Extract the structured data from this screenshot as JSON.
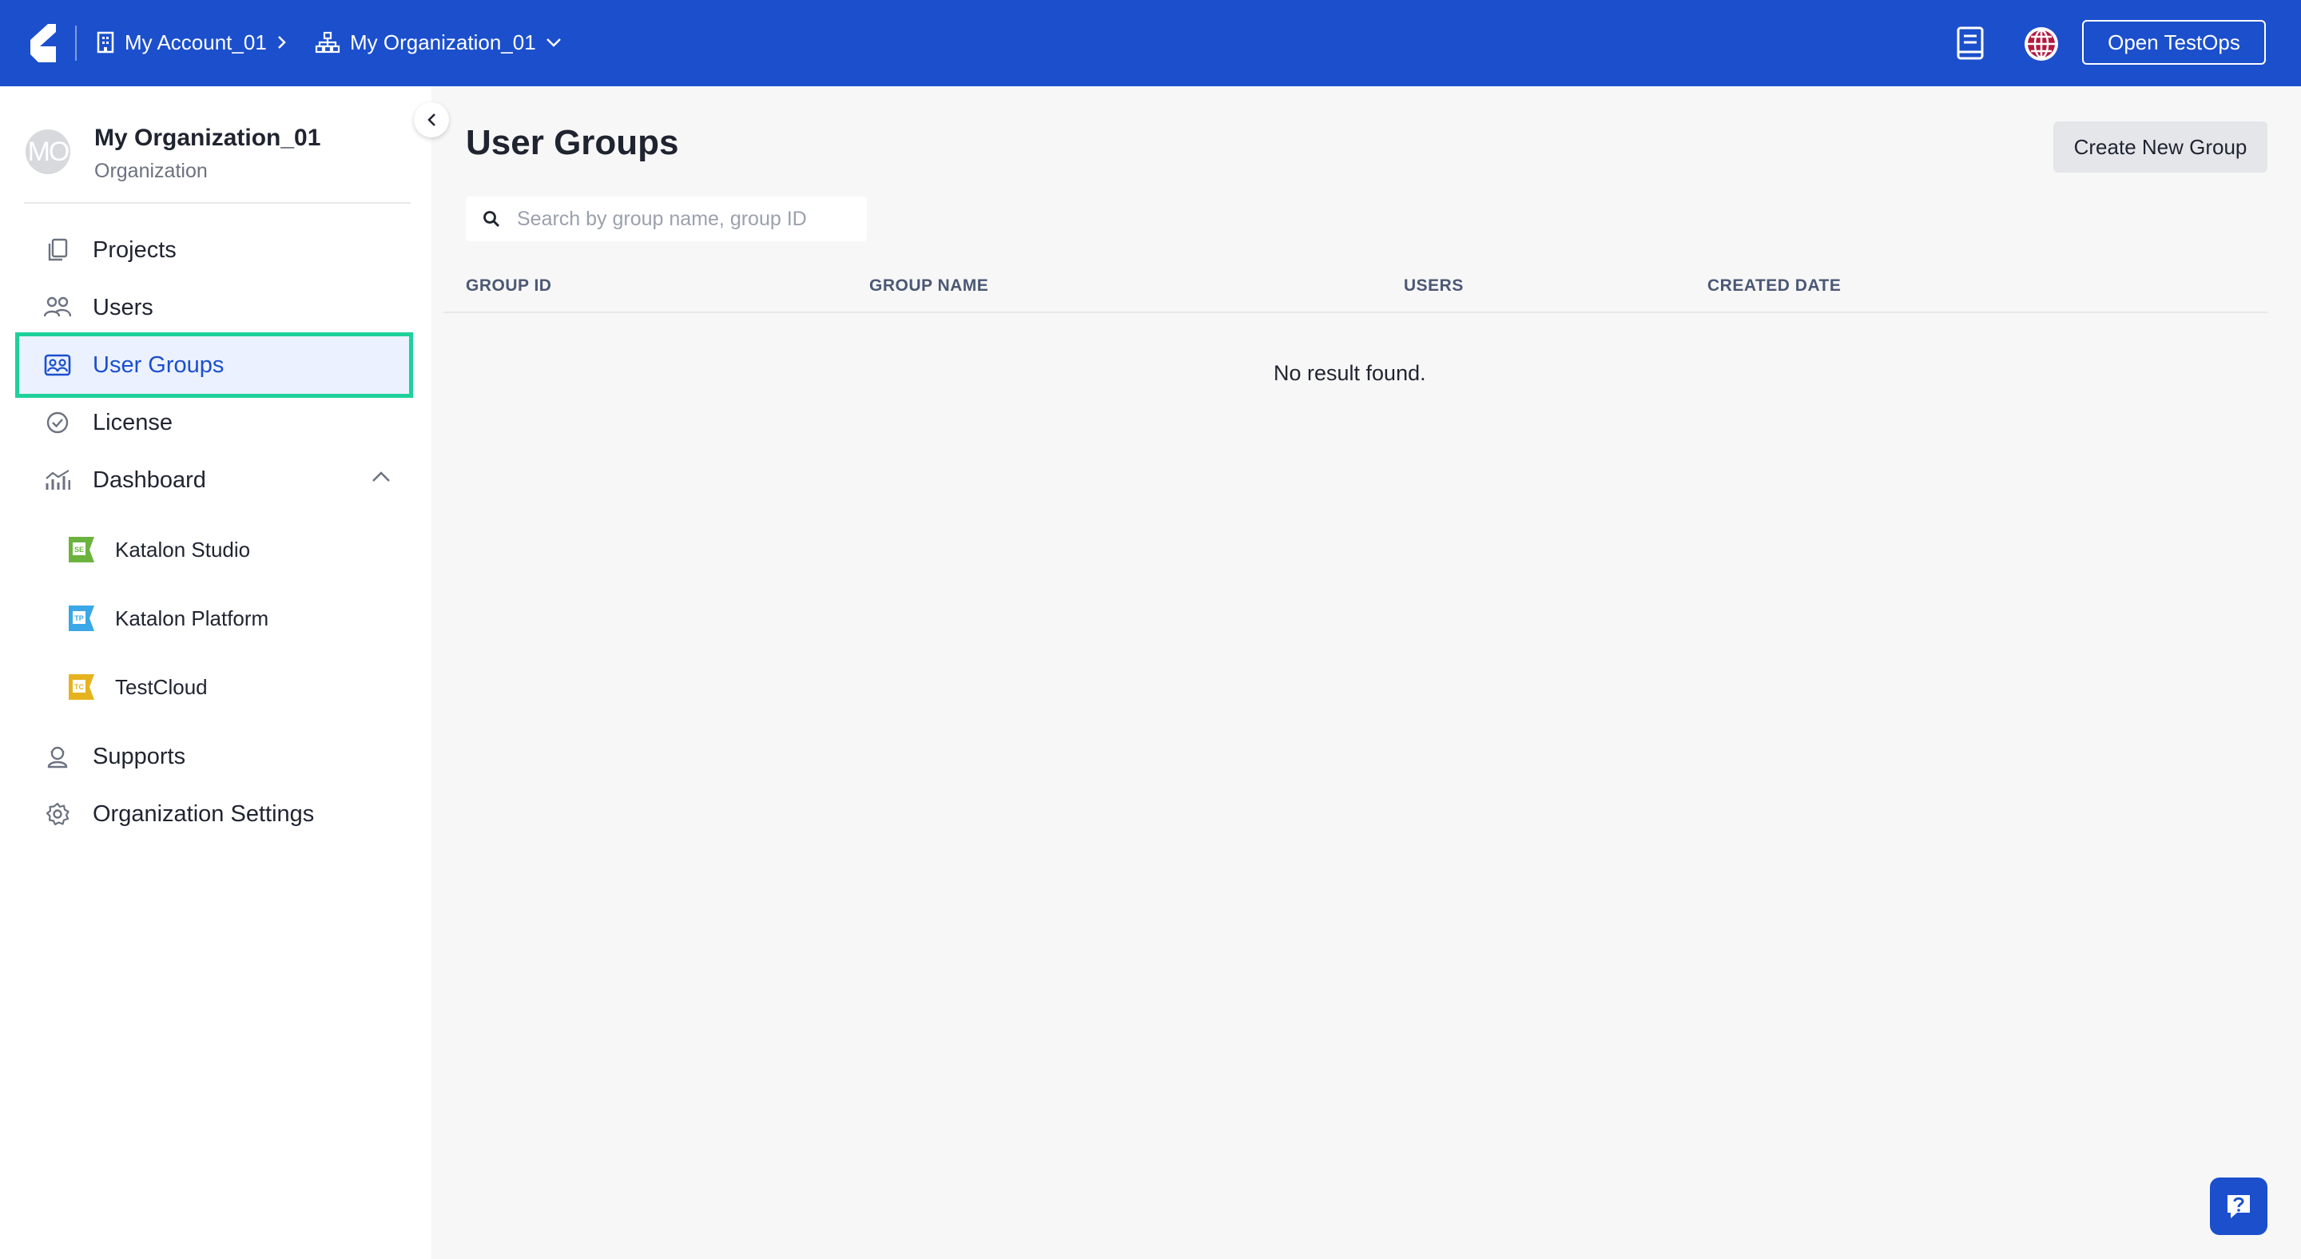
{
  "topbar": {
    "account": "My Account_01",
    "organization": "My Organization_01",
    "open_button": "Open TestOps",
    "brand_color": "#1b4fcc"
  },
  "sidebar": {
    "org_avatar": "MO",
    "org_name": "My Organization_01",
    "org_type": "Organization",
    "items": [
      {
        "label": "Projects",
        "icon": "projects-icon"
      },
      {
        "label": "Users",
        "icon": "users-icon"
      },
      {
        "label": "User Groups",
        "icon": "user-groups-icon",
        "active": true
      },
      {
        "label": "License",
        "icon": "license-icon"
      },
      {
        "label": "Dashboard",
        "icon": "dashboard-icon",
        "expanded": true
      },
      {
        "label": "Supports",
        "icon": "supports-icon"
      },
      {
        "label": "Organization Settings",
        "icon": "gear-icon"
      }
    ],
    "dashboard_children": [
      {
        "label": "Katalon Studio",
        "icon": "katalon-studio-icon"
      },
      {
        "label": "Katalon Platform",
        "icon": "katalon-platform-icon"
      },
      {
        "label": "TestCloud",
        "icon": "testcloud-icon"
      }
    ]
  },
  "main": {
    "title": "User Groups",
    "create_button": "Create New Group",
    "search_placeholder": "Search by group name, group ID",
    "columns": [
      "GROUP ID",
      "GROUP NAME",
      "USERS",
      "CREATED DATE"
    ],
    "empty_message": "No result found."
  }
}
